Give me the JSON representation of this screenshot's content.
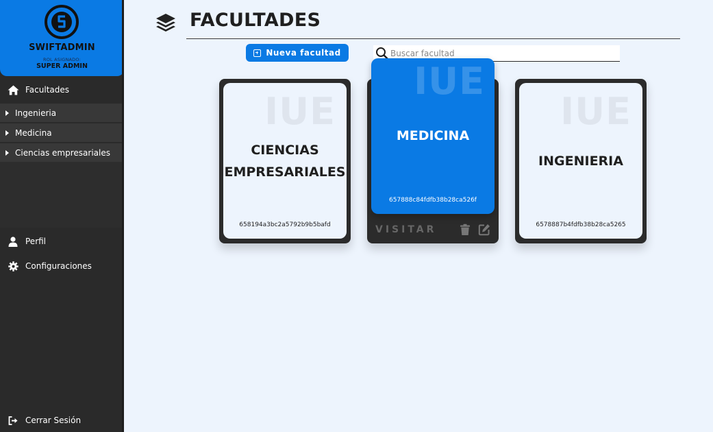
{
  "brand": {
    "name": "SWIFTADMIN",
    "role_label": "ROL ASIGNADO:",
    "role": "SUPER ADMIN"
  },
  "sidebar": {
    "main_item": {
      "label": "Facultades",
      "icon": "home-icon"
    },
    "sub_items": [
      {
        "label": "Ingenieria"
      },
      {
        "label": "Medicina"
      },
      {
        "label": "Ciencias empresariales"
      }
    ],
    "profile": {
      "label": "Perfil",
      "icon": "user-icon"
    },
    "settings": {
      "label": "Configuraciones",
      "icon": "gear-icon"
    },
    "logout": {
      "label": "Cerrar Sesión",
      "icon": "logout-icon"
    }
  },
  "header": {
    "title": "FACULTADES",
    "icon": "layers-icon"
  },
  "toolbar": {
    "new_label": "Nueva facultad",
    "search_placeholder": "Buscar facultad"
  },
  "cards": [
    {
      "watermark": "IUE",
      "name_line1": "CIENCIAS",
      "name_line2": "EMPRESARIALES",
      "id": "658194a3bc2a5792b9b5bafd"
    },
    {
      "watermark": "IUE",
      "name_line1": "MEDICINA",
      "id": "657888c84fdfb38b28ca526f",
      "visit_label": "VISITAR"
    },
    {
      "watermark": "IUE",
      "name_line1": "INGENIERIA",
      "id": "6578887b4fdfb38b28ca5265"
    }
  ],
  "colors": {
    "accent": "#0a7ae4",
    "sidebar": "#2a2a2a",
    "background": "#edf4fd"
  }
}
